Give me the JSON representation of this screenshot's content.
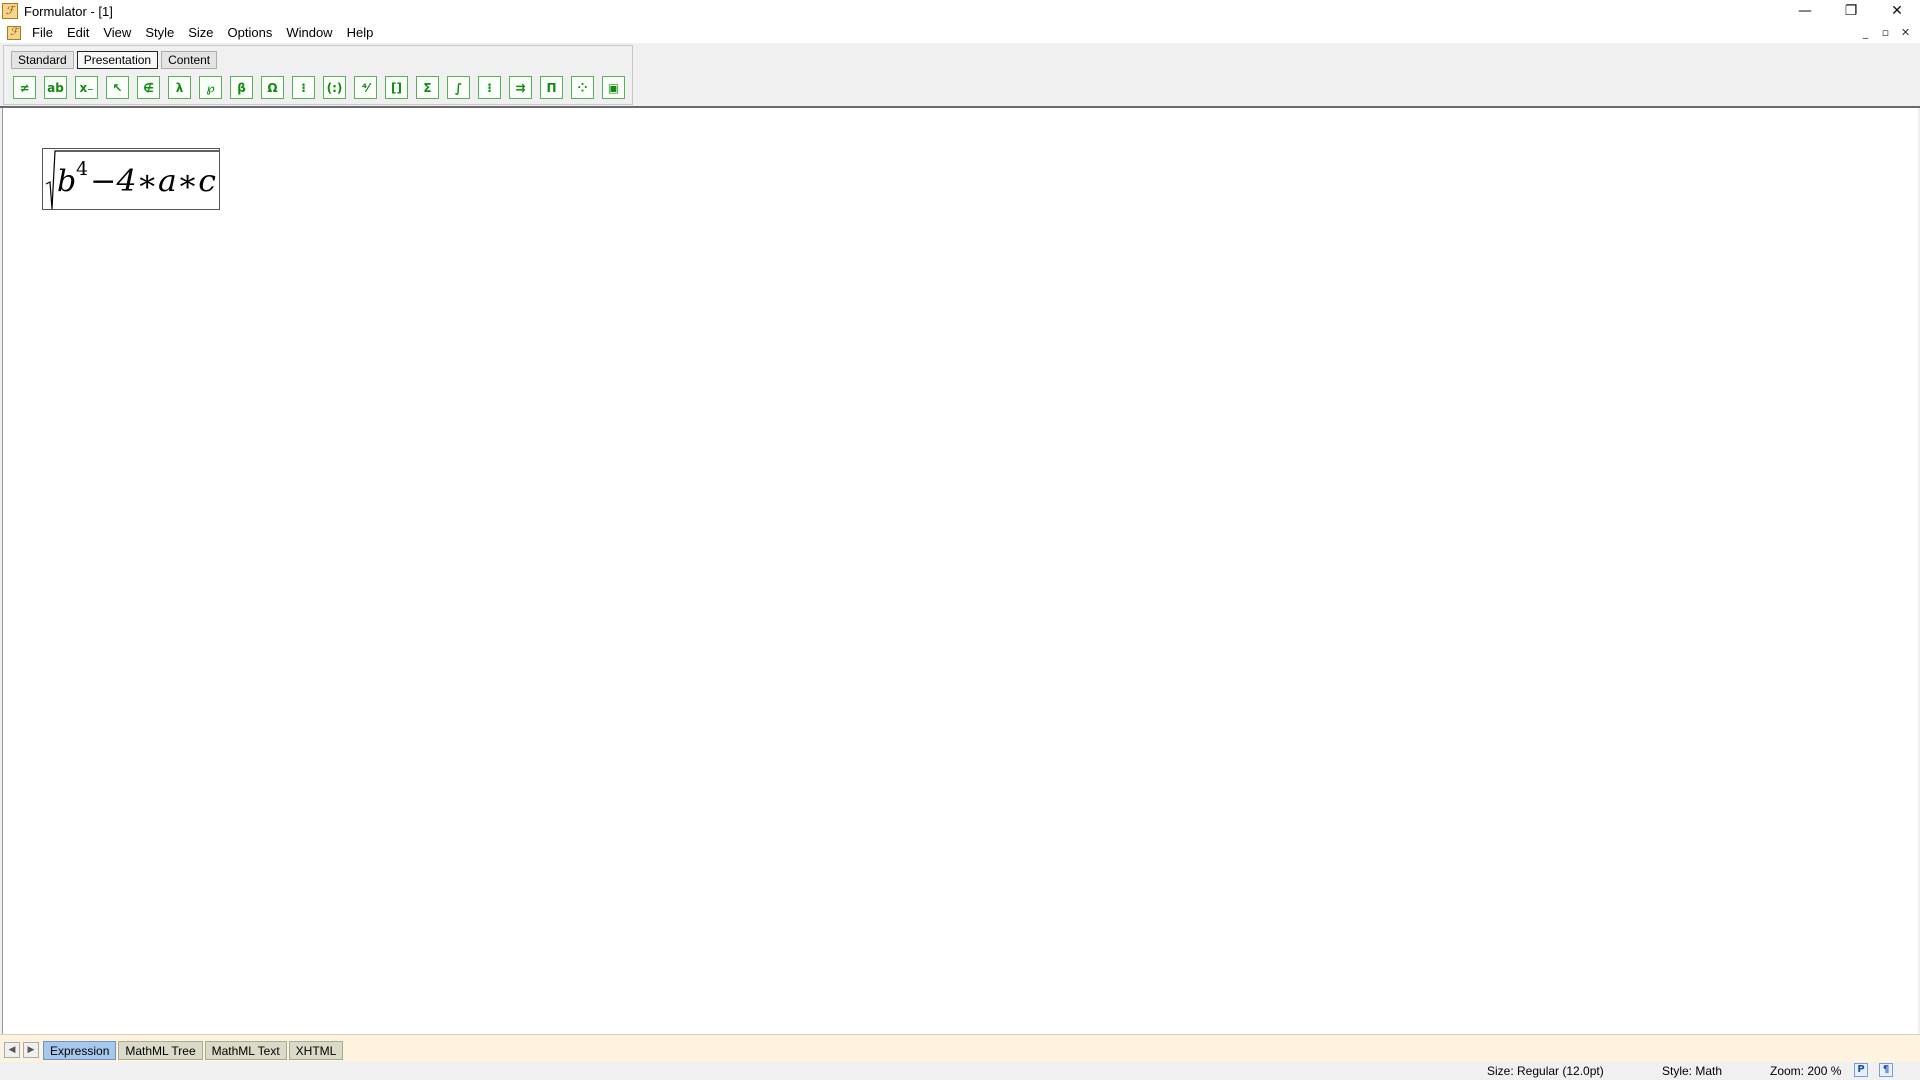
{
  "window": {
    "title": "Formulator - [1]",
    "controls": [
      "—",
      "❐",
      "✕"
    ]
  },
  "menu": {
    "items": [
      "File",
      "Edit",
      "View",
      "Style",
      "Size",
      "Options",
      "Window",
      "Help"
    ],
    "mdi_controls": [
      "_",
      "▫",
      "✕"
    ]
  },
  "toolbar": {
    "tabs": [
      "Standard",
      "Presentation",
      "Content"
    ],
    "active_tab": "Presentation",
    "palette_icons": [
      "not-equal-icon",
      "ab-icon",
      "subscript-icon",
      "arrow-icon",
      "not-element-icon",
      "lambda-icon",
      "script-icon",
      "beta-icon",
      "omega-icon",
      "matrix-brackets-icon",
      "parentheses-icon",
      "fraction-icon",
      "superscript-box-icon",
      "sum-icon",
      "integral-icon",
      "underover-icon",
      "arrow-over-icon",
      "product-icon",
      "table-icon",
      "frame-icon"
    ],
    "palette_glyphs": [
      "≠",
      "ab",
      "x₋",
      "↖",
      "∉",
      "λ",
      "℘",
      "β",
      "Ω",
      "⁝",
      "(:)",
      "⁴⁄",
      "[]",
      "Σ",
      "∫",
      "⁝",
      "⇉",
      "Π",
      "⁘",
      "▣"
    ]
  },
  "formula": {
    "base": "b",
    "exponent": "4",
    "rest": "−4∗a∗c"
  },
  "bottom_tabs": {
    "items": [
      "Expression",
      "MathML Tree",
      "MathML Text",
      "XHTML"
    ],
    "active": "Expression"
  },
  "status": {
    "size": "Size: Regular (12.0pt)",
    "style": "Style: Math",
    "zoom": "Zoom: 200 %",
    "icon_p": "P",
    "icon_para": "¶"
  }
}
